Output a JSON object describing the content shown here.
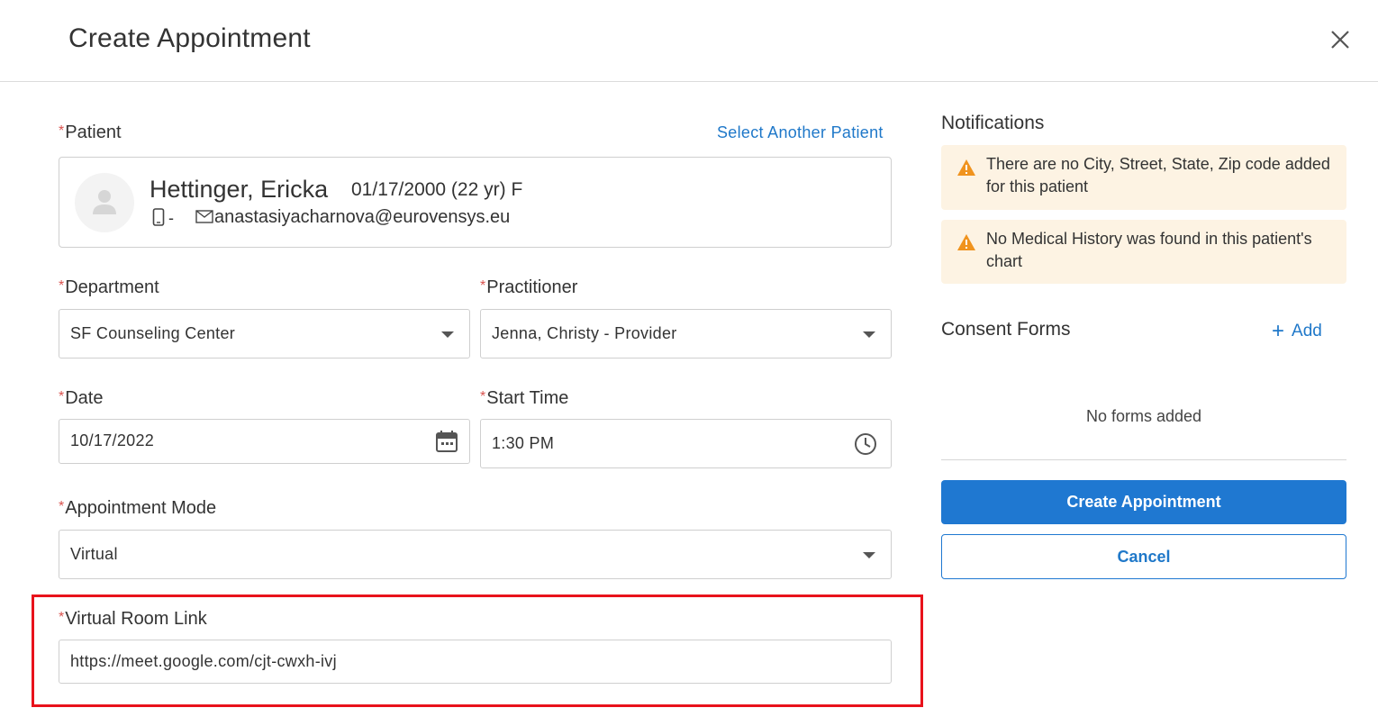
{
  "header": {
    "title": "Create Appointment"
  },
  "required_mark": "*",
  "patient": {
    "label": "Patient",
    "select_another": "Select Another Patient",
    "name": "Hettinger, Ericka",
    "dob_info": "01/17/2000 (22 yr) F",
    "phone": "-",
    "email": "anastasiyacharnova@eurovensys.eu"
  },
  "department": {
    "label": "Department",
    "value": "SF Counseling Center"
  },
  "practitioner": {
    "label": "Practitioner",
    "value": "Jenna, Christy - Provider"
  },
  "date": {
    "label": "Date",
    "value": "10/17/2022"
  },
  "start_time": {
    "label": "Start Time",
    "value": "1:30 PM"
  },
  "appointment_mode": {
    "label": "Appointment Mode",
    "value": "Virtual"
  },
  "virtual_room": {
    "label": "Virtual Room Link",
    "value": "https://meet.google.com/cjt-cwxh-ivj"
  },
  "notifications": {
    "title": "Notifications",
    "items": [
      "There are no City, Street, State, Zip code added for this patient",
      "No Medical History was found in this patient's chart"
    ]
  },
  "consent_forms": {
    "title": "Consent Forms",
    "add_label": "Add",
    "empty_text": "No forms added"
  },
  "actions": {
    "create_label": "Create Appointment",
    "cancel_label": "Cancel"
  },
  "colors": {
    "accent": "#1f78d1",
    "required": "#d9534f",
    "warning_bg": "#fdf3e3",
    "warning_icon": "#f0931e",
    "highlight": "#e8121b"
  },
  "icons": [
    "close-icon",
    "user-avatar-icon",
    "phone-icon",
    "mail-icon",
    "chevron-down-icon",
    "calendar-icon",
    "clock-icon",
    "warning-icon",
    "plus-icon"
  ]
}
